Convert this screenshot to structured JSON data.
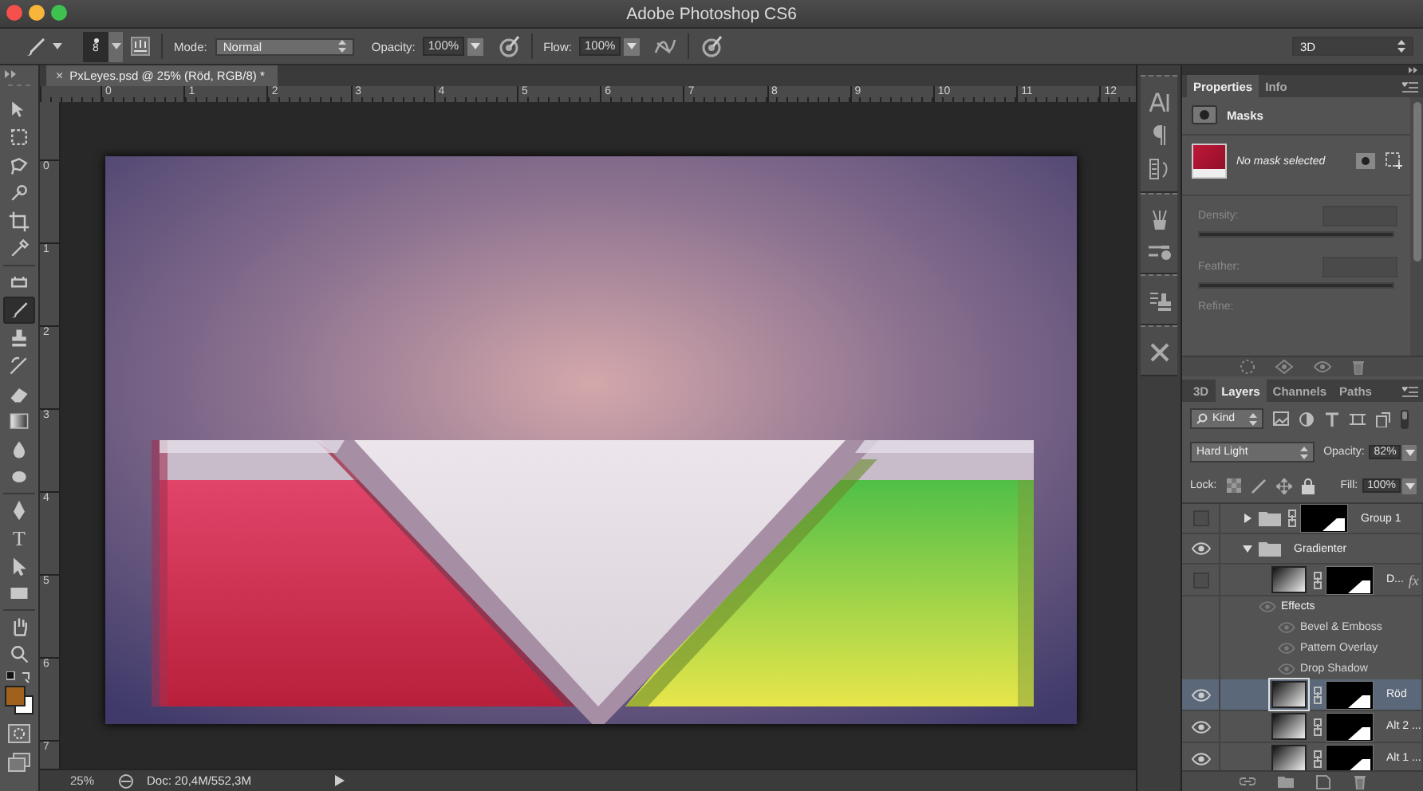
{
  "window": {
    "title": "Adobe Photoshop CS6"
  },
  "options_bar": {
    "brush_size": "8",
    "mode_label": "Mode:",
    "mode": "Normal",
    "opacity_label": "Opacity:",
    "opacity": "100%",
    "flow_label": "Flow:",
    "flow": "100%",
    "workspace": "3D"
  },
  "tools": [
    {
      "kind": "move",
      "selected": false
    },
    {
      "kind": "marquee",
      "selected": false
    },
    {
      "kind": "lasso",
      "selected": false
    },
    {
      "kind": "quick-select",
      "selected": false
    },
    {
      "kind": "crop",
      "selected": false
    },
    {
      "kind": "eyedropper",
      "selected": false
    },
    {
      "kind": "healing",
      "selected": false
    },
    {
      "kind": "brush",
      "selected": true
    },
    {
      "kind": "stamp",
      "selected": false
    },
    {
      "kind": "history-brush",
      "selected": false
    },
    {
      "kind": "eraser",
      "selected": false
    },
    {
      "kind": "gradient",
      "selected": false
    },
    {
      "kind": "blur",
      "selected": false
    },
    {
      "kind": "dodge",
      "selected": false
    },
    {
      "kind": "pen",
      "selected": false
    },
    {
      "kind": "type",
      "glyph": "T",
      "selected": false
    },
    {
      "kind": "path-select",
      "selected": false
    },
    {
      "kind": "shape",
      "selected": false
    },
    {
      "kind": "hand",
      "selected": false
    },
    {
      "kind": "zoom",
      "selected": false
    }
  ],
  "swatches": [
    {
      "color": "#a0611c"
    },
    {
      "color": "#ffffff"
    }
  ],
  "document_tab": {
    "close": "×",
    "title": "PxLeyes.psd @ 25% (Röd, RGB/8) *",
    "selected": true
  },
  "rulers": {
    "horizontal": [
      "0",
      "1",
      "2",
      "3",
      "4",
      "5",
      "6",
      "7",
      "8",
      "9",
      "10",
      "11",
      "12"
    ],
    "vertical": [
      "0",
      "1",
      "2",
      "3",
      "4",
      "5",
      "6",
      "7"
    ]
  },
  "status_bar": {
    "zoom": "25%",
    "doc": "Doc: 20,4M/552,3M"
  },
  "properties_panel": {
    "tabs": [
      {
        "label": "Properties",
        "selected": true
      },
      {
        "label": "Info",
        "selected": false
      }
    ],
    "section": "Masks",
    "mask_status": "No mask selected",
    "fields": [
      {
        "label": "Density:",
        "disabled": true
      },
      {
        "label": "Feather:",
        "disabled": true
      }
    ],
    "refine_label": "Refine:"
  },
  "layers_panel": {
    "tabs": [
      {
        "label": "3D",
        "selected": false
      },
      {
        "label": "Layers",
        "selected": true
      },
      {
        "label": "Channels",
        "selected": false
      },
      {
        "label": "Paths",
        "selected": false
      }
    ],
    "filter": "Kind",
    "blend_mode": "Hard Light",
    "opacity_label": "Opacity:",
    "opacity": "82%",
    "lock_label": "Lock:",
    "fill_label": "Fill:",
    "fill": "100%",
    "layers": [
      {
        "kind": "group",
        "name": "Group 1",
        "visible": false,
        "expanded": false,
        "mask": true,
        "selected": false
      },
      {
        "kind": "group",
        "name": "Gradienter",
        "visible": true,
        "expanded": true,
        "mask": false,
        "selected": false,
        "children": [
          {
            "kind": "layer",
            "name": "D...",
            "visible": false,
            "mask": true,
            "fx_label": "fx",
            "selected": false,
            "children": [
              {
                "kind": "effects",
                "name": "Effects",
                "children": [
                  {
                    "kind": "effect",
                    "name": "Bevel & Emboss"
                  },
                  {
                    "kind": "effect",
                    "name": "Pattern Overlay"
                  },
                  {
                    "kind": "effect",
                    "name": "Drop Shadow"
                  }
                ]
              }
            ]
          },
          {
            "kind": "layer",
            "name": "Röd",
            "visible": true,
            "mask": true,
            "selected": true
          },
          {
            "kind": "layer",
            "name": "Alt 2 ...",
            "visible": true,
            "mask": true,
            "selected": false
          },
          {
            "kind": "layer",
            "name": "Alt 1 ...",
            "visible": true,
            "mask": true,
            "selected": false
          }
        ]
      }
    ]
  }
}
